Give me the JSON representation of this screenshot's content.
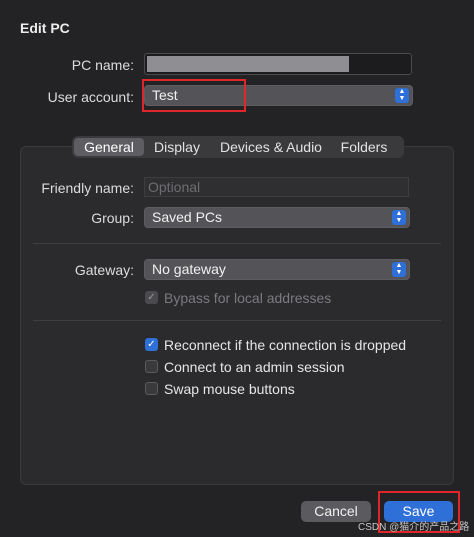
{
  "dialog": {
    "title": "Edit PC"
  },
  "connection": {
    "pc_name_label": "PC name:",
    "user_account_label": "User account:",
    "user_account_value": "Test"
  },
  "tabs": [
    {
      "label": "General",
      "active": true
    },
    {
      "label": "Display",
      "active": false
    },
    {
      "label": "Devices & Audio",
      "active": false
    },
    {
      "label": "Folders",
      "active": false
    }
  ],
  "general": {
    "friendly_name_label": "Friendly name:",
    "friendly_name_placeholder": "Optional",
    "group_label": "Group:",
    "group_value": "Saved PCs",
    "gateway_label": "Gateway:",
    "gateway_value": "No gateway",
    "bypass_label": "Bypass for local addresses",
    "bypass_checked": true,
    "bypass_enabled": false,
    "reconnect_label": "Reconnect if the connection is dropped",
    "reconnect_checked": true,
    "admin_session_label": "Connect to an admin session",
    "admin_session_checked": false,
    "swap_mouse_label": "Swap mouse buttons",
    "swap_mouse_checked": false
  },
  "buttons": {
    "cancel": "Cancel",
    "save": "Save"
  },
  "watermark": "CSDN @猫介的产品之路",
  "colors": {
    "accent": "#2f6fd8",
    "highlight": "#e0262a"
  }
}
